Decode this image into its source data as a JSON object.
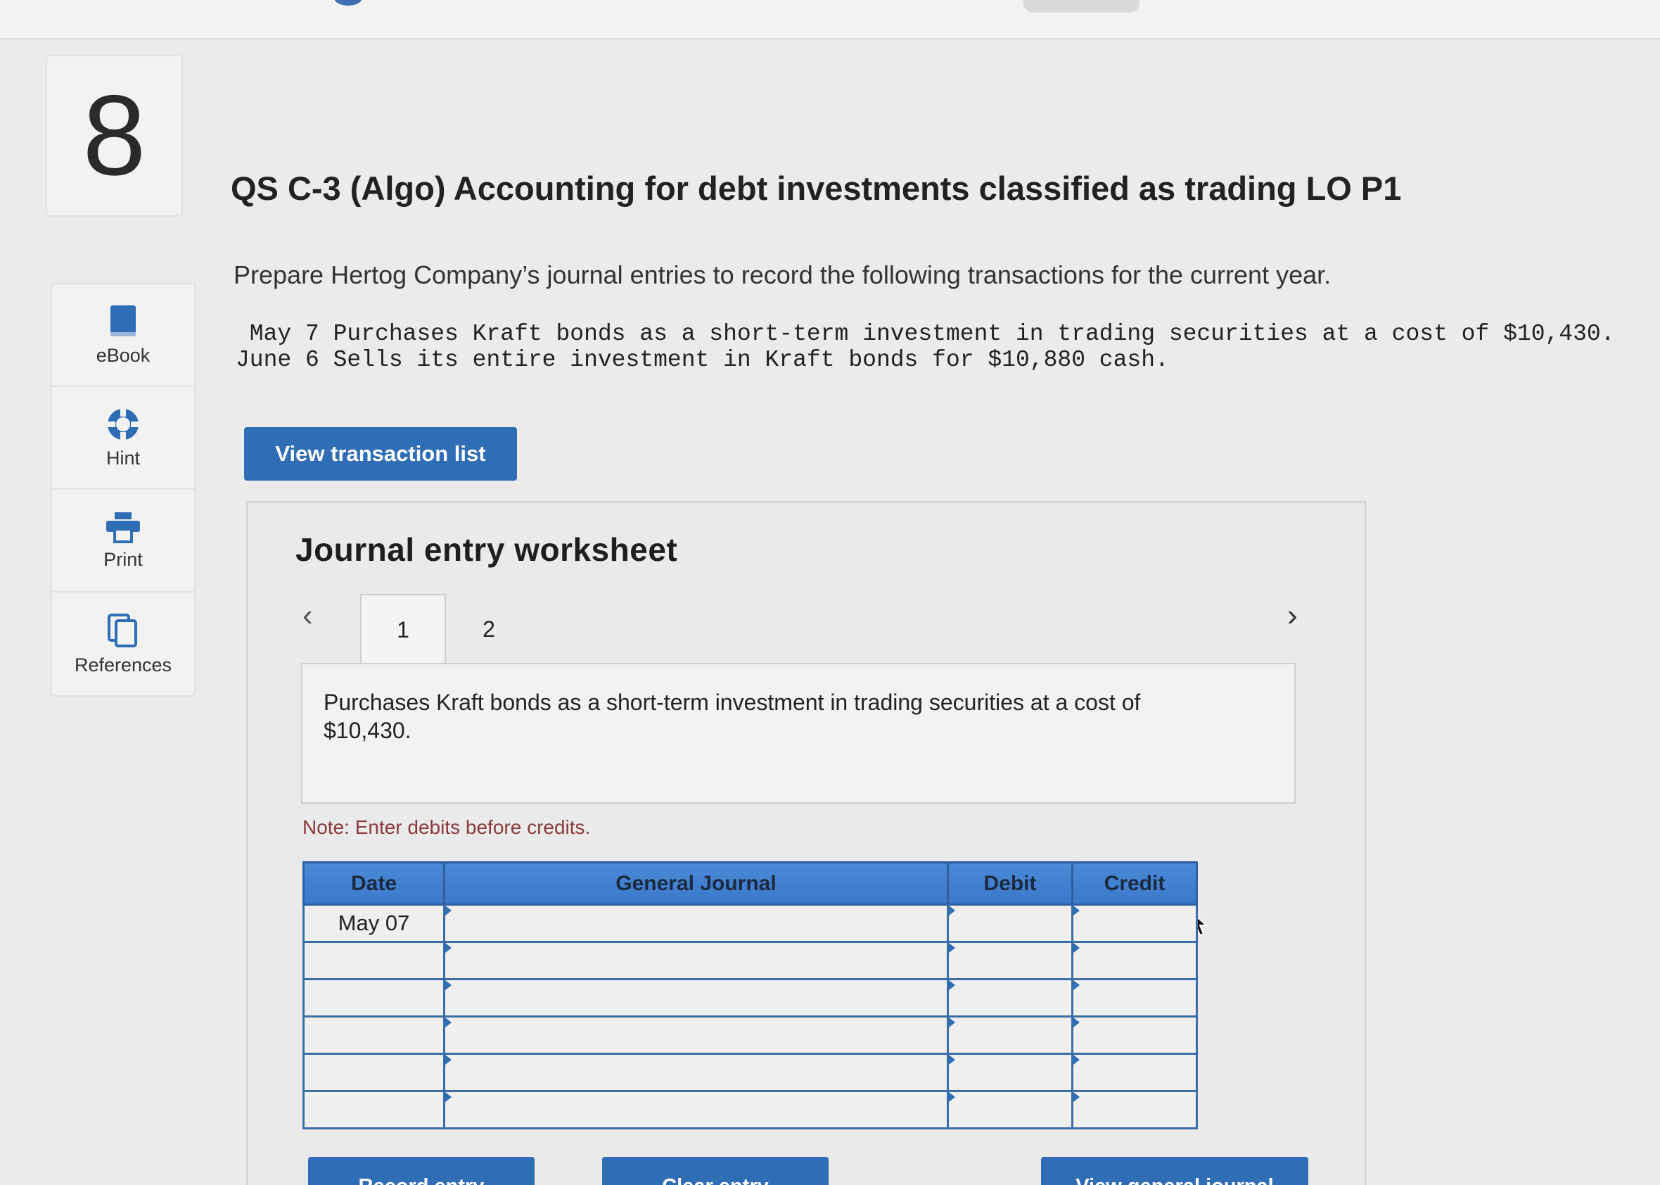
{
  "question_number": "8",
  "sidebar": {
    "items": [
      {
        "label": "eBook",
        "icon": "book-icon"
      },
      {
        "label": "Hint",
        "icon": "lifebuoy-icon"
      },
      {
        "label": "Print",
        "icon": "printer-icon"
      },
      {
        "label": "References",
        "icon": "copy-icon"
      }
    ]
  },
  "question": {
    "title": "QS C-3 (Algo) Accounting for debt investments classified as trading LO P1",
    "intro": "Prepare Hertog Company’s journal entries to record the following transactions for the current year.",
    "transactions": [
      " May 7 Purchases Kraft bonds as a short-term investment in trading securities at a cost of $10,430.",
      "June 6 Sells its entire investment in Kraft bonds for $10,880 cash."
    ]
  },
  "buttons": {
    "view_transaction_list": "View transaction list",
    "record_entry": "Record entry",
    "clear_entry": "Clear entry",
    "view_general_journal": "View general journal"
  },
  "worksheet": {
    "title": "Journal entry worksheet",
    "tabs": [
      "1",
      "2"
    ],
    "active_tab": "1",
    "description": "Purchases Kraft bonds as a short-term investment in trading securities at a cost of $10,430.",
    "note": "Note: Enter debits before credits.",
    "table": {
      "headers": [
        "Date",
        "General Journal",
        "Debit",
        "Credit"
      ],
      "rows": [
        {
          "date": "May 07",
          "account": "",
          "debit": "",
          "credit": ""
        },
        {
          "date": "",
          "account": "",
          "debit": "",
          "credit": ""
        },
        {
          "date": "",
          "account": "",
          "debit": "",
          "credit": ""
        },
        {
          "date": "",
          "account": "",
          "debit": "",
          "credit": ""
        },
        {
          "date": "",
          "account": "",
          "debit": "",
          "credit": ""
        },
        {
          "date": "",
          "account": "",
          "debit": "",
          "credit": ""
        }
      ]
    }
  },
  "colors": {
    "accent": "#2f6db5",
    "table_header": "#3f7fcf",
    "note_text": "#8b3a3a"
  }
}
